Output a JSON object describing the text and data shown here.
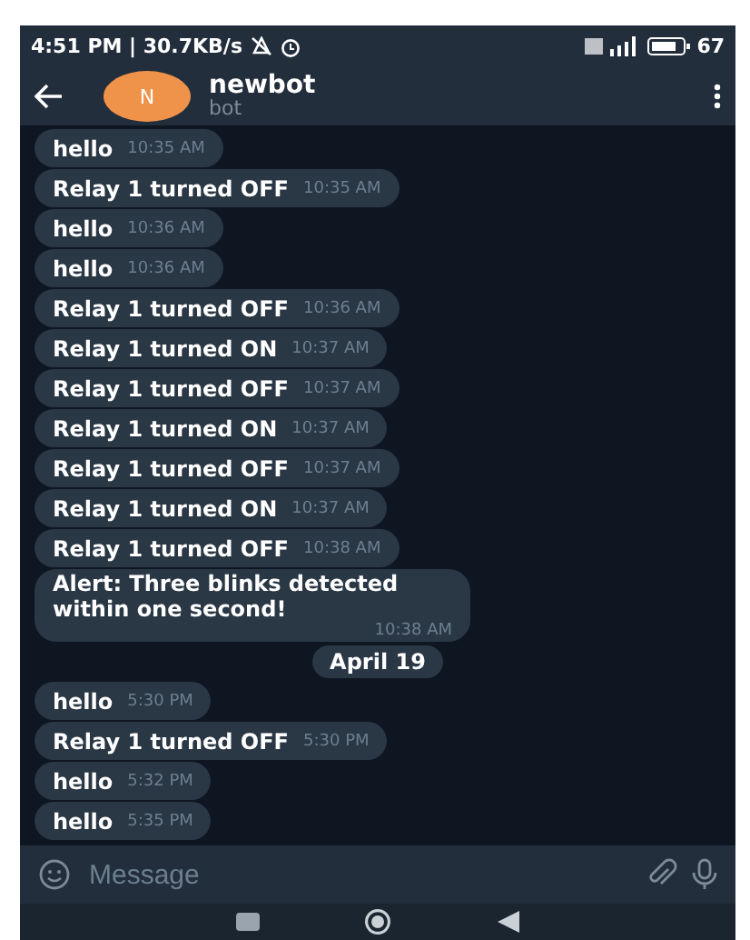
{
  "status_bar": {
    "time_speed": "4:51 PM | 30.7KB/s",
    "battery": "67"
  },
  "header": {
    "avatar_letter": "N",
    "title": "newbot",
    "subtitle": "bot"
  },
  "messages": [
    {
      "kind": "message",
      "text": "hello",
      "time": "10:35 AM"
    },
    {
      "kind": "message",
      "text": "Relay 1 turned OFF",
      "time": "10:35 AM"
    },
    {
      "kind": "message",
      "text": "hello",
      "time": "10:36 AM"
    },
    {
      "kind": "message",
      "text": "hello",
      "time": "10:36 AM"
    },
    {
      "kind": "message",
      "text": "Relay 1 turned OFF",
      "time": "10:36 AM"
    },
    {
      "kind": "message",
      "text": "Relay 1 turned ON",
      "time": "10:37 AM"
    },
    {
      "kind": "message",
      "text": "Relay 1 turned OFF",
      "time": "10:37 AM"
    },
    {
      "kind": "message",
      "text": "Relay 1 turned ON",
      "time": "10:37 AM"
    },
    {
      "kind": "message",
      "text": "Relay 1 turned OFF",
      "time": "10:37 AM"
    },
    {
      "kind": "message",
      "text": "Relay 1 turned ON",
      "time": "10:37 AM"
    },
    {
      "kind": "message",
      "text": "Relay 1 turned OFF",
      "time": "10:38 AM"
    },
    {
      "kind": "long",
      "text": "Alert: Three blinks detected within one second!",
      "time": "10:38 AM"
    },
    {
      "kind": "date",
      "text": "April 19"
    },
    {
      "kind": "message",
      "text": "hello",
      "time": "5:30 PM"
    },
    {
      "kind": "message",
      "text": "Relay 1 turned OFF",
      "time": "5:30 PM"
    },
    {
      "kind": "message",
      "text": "hello",
      "time": "5:32 PM"
    },
    {
      "kind": "message",
      "text": "hello",
      "time": "5:35 PM"
    }
  ],
  "composer": {
    "placeholder": "Message"
  }
}
